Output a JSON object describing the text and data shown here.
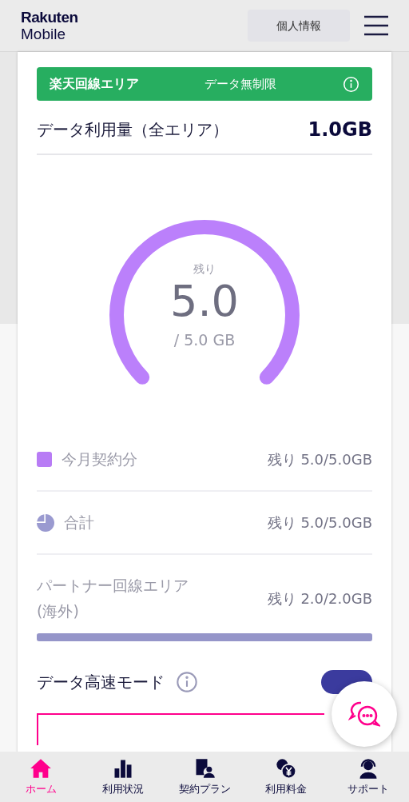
{
  "header": {
    "logo_top": "Rakuten",
    "logo_bottom": "Mobile",
    "profile_button": "個人情報"
  },
  "area_banner": {
    "label": "楽天回線エリア",
    "status": "データ無制限"
  },
  "usage": {
    "title": "データ利用量（全エリア）",
    "value": "1.0GB"
  },
  "gauge": {
    "caption": "残り",
    "value": "5.0",
    "total": "/ 5.0 GB"
  },
  "breakdown": [
    {
      "kind": "square",
      "color": "#b87cf5",
      "label": "今月契約分",
      "reading": "残り 5.0/5.0GB"
    },
    {
      "kind": "pie",
      "color": "#9a9ad0",
      "label": "合計",
      "reading": "残り 5.0/5.0GB"
    }
  ],
  "partner": {
    "label": "パートナー回線エリア",
    "sublabel": "(海外)",
    "reading": "残り 2.0/2.0GB",
    "level": 1
  },
  "high_speed": {
    "label": "データ高速モード",
    "on": true
  },
  "nav": [
    {
      "label": "ホーム",
      "selected": true,
      "kind": "home"
    },
    {
      "label": "利用状況",
      "selected": false,
      "kind": "usage"
    },
    {
      "label": "契約プラン",
      "selected": false,
      "kind": "plan"
    },
    {
      "label": "利用料金",
      "selected": false,
      "kind": "fee"
    },
    {
      "label": "サポート",
      "selected": false,
      "kind": "support"
    }
  ]
}
